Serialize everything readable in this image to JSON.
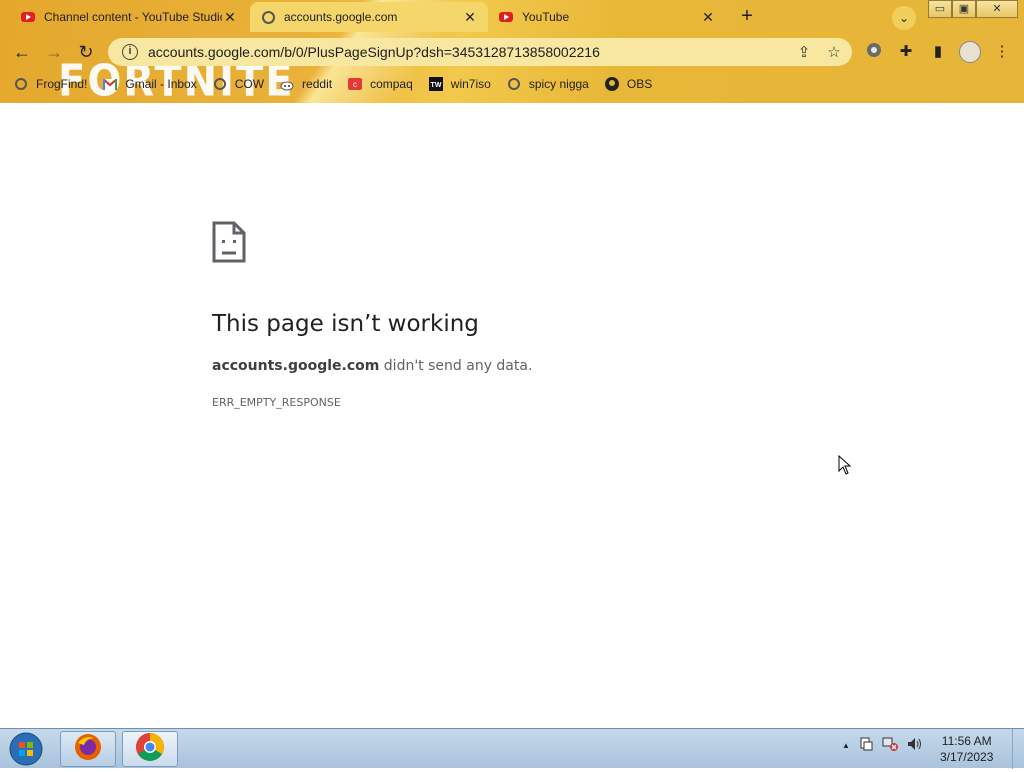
{
  "tabs": [
    {
      "title": "Channel content - YouTube Studio",
      "icon": "youtube-icon",
      "active": false
    },
    {
      "title": "accounts.google.com",
      "icon": "globe-icon",
      "active": true
    },
    {
      "title": "YouTube",
      "icon": "youtube-icon",
      "active": false
    }
  ],
  "tab_close": "✕",
  "new_tab": "+",
  "tab_search": "⌄",
  "window_controls": {
    "minimize": "▭",
    "maximize": "▣",
    "close": "✕"
  },
  "toolbar": {
    "back": "←",
    "forward": "→",
    "reload": "↻",
    "info": "i",
    "url": "accounts.google.com/b/0/PlusPageSignUp?dsh=3453128713858002216",
    "share": "⇪",
    "bookmark_star": "☆",
    "extensions": "✚",
    "sidepanel": "▮",
    "menu": "⋮"
  },
  "background_text": "FORTNITE",
  "bookmarks": [
    {
      "label": "FrogFind!",
      "icon": "globe-icon"
    },
    {
      "label": "Gmail - Inbox",
      "icon": "gmail-icon"
    },
    {
      "label": "COW",
      "icon": "globe-icon"
    },
    {
      "label": "reddit",
      "icon": "reddit-icon"
    },
    {
      "label": "compaq",
      "icon": "compaq-icon"
    },
    {
      "label": "win7iso",
      "icon": "win7iso-icon"
    },
    {
      "label": "spicy nigga",
      "icon": "globe-icon"
    },
    {
      "label": "OBS",
      "icon": "github-icon"
    }
  ],
  "error": {
    "title": "This page isn’t working",
    "host": "accounts.google.com",
    "message": " didn't send any data.",
    "code": "ERR_EMPTY_RESPONSE"
  },
  "taskbar": {
    "apps": [
      "firefox-icon",
      "chrome-icon"
    ],
    "tray_arrow": "▲",
    "clock_time": "11:56 AM",
    "clock_date": "3/17/2023"
  }
}
